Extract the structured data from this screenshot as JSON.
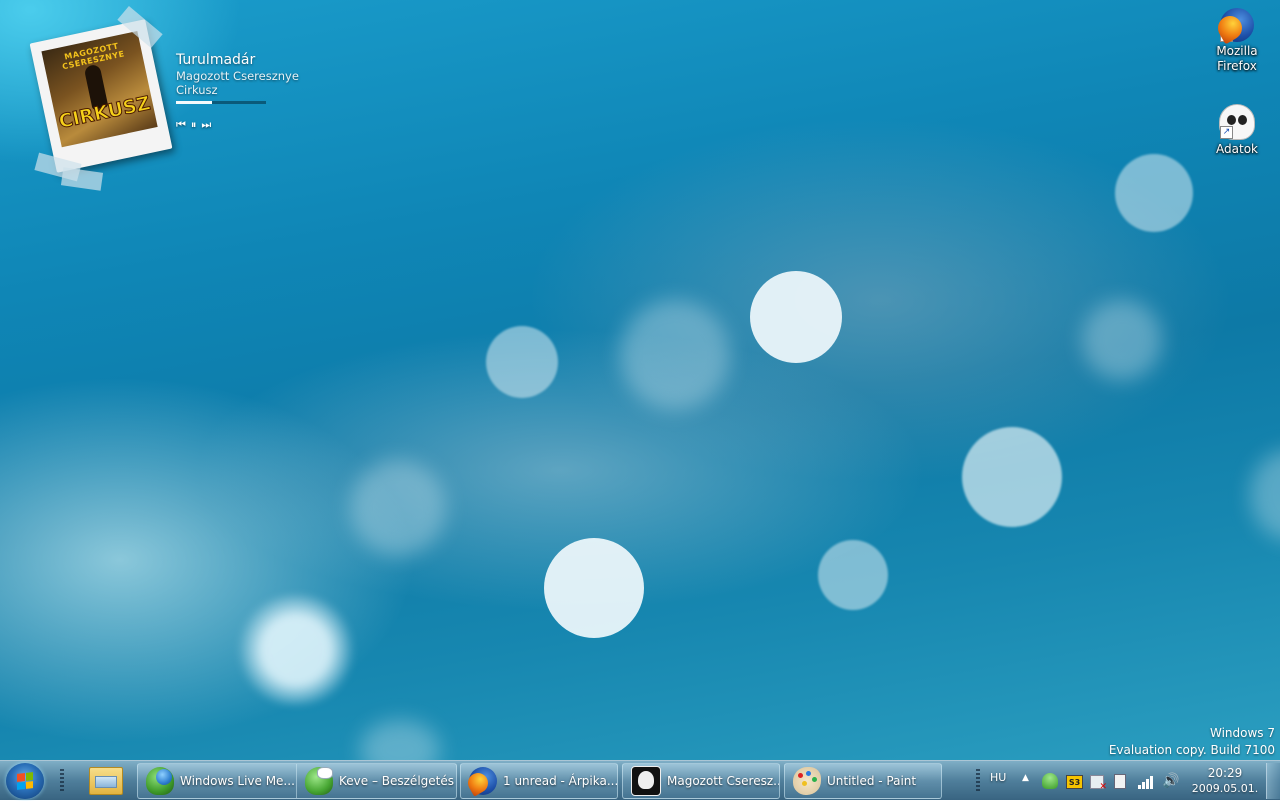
{
  "media_player": {
    "track_title": "Turulmadár",
    "artist": "Magozott Cseresznye",
    "album": "Cirkusz",
    "album_art_band_text": "MAGOZOTT CSERESZNYE",
    "album_art_title_text": "CIRKUSZ",
    "progress_fraction": 0.4,
    "controls": {
      "previous_icon": "⏮",
      "pause_icon": "⏸",
      "next_icon": "⏭"
    }
  },
  "desktop_icons": [
    {
      "label": "Mozilla Firefox",
      "icon": "firefox-icon"
    },
    {
      "label": "Adatok",
      "icon": "skull-icon"
    }
  ],
  "watermark": {
    "line1": "Windows 7",
    "line2": "Evaluation copy. Build 7100"
  },
  "taskbar": {
    "start_icon": "windows-logo-icon",
    "pinned": [
      {
        "icon": "explorer-folder-icon"
      }
    ],
    "windows": [
      {
        "label": "Windows Live Me...",
        "icon": "msn-messenger-icon"
      },
      {
        "label": "Keve – Beszélgetés",
        "icon": "msn-chat-icon"
      },
      {
        "label": "1 unread - Árpika...",
        "icon": "firefox-icon"
      },
      {
        "label": "Magozott Cseresz...",
        "icon": "skull-icon"
      },
      {
        "label": "Untitled - Paint",
        "icon": "paint-icon"
      }
    ],
    "tray": {
      "language": "HU",
      "expand_icon": "▲",
      "icons": [
        "msn-status-icon",
        "s3-icon",
        "network-error-icon",
        "power-icon",
        "signal-icon",
        "volume-icon"
      ],
      "s3_text": "S3",
      "volume_glyph": "🔊",
      "time": "20:29",
      "date": "2009.05.01."
    }
  },
  "colors": {
    "desktop_blue": "#0f86b6",
    "taskbar": "#4a7fa0",
    "album_title_yellow": "#f6d21a"
  }
}
